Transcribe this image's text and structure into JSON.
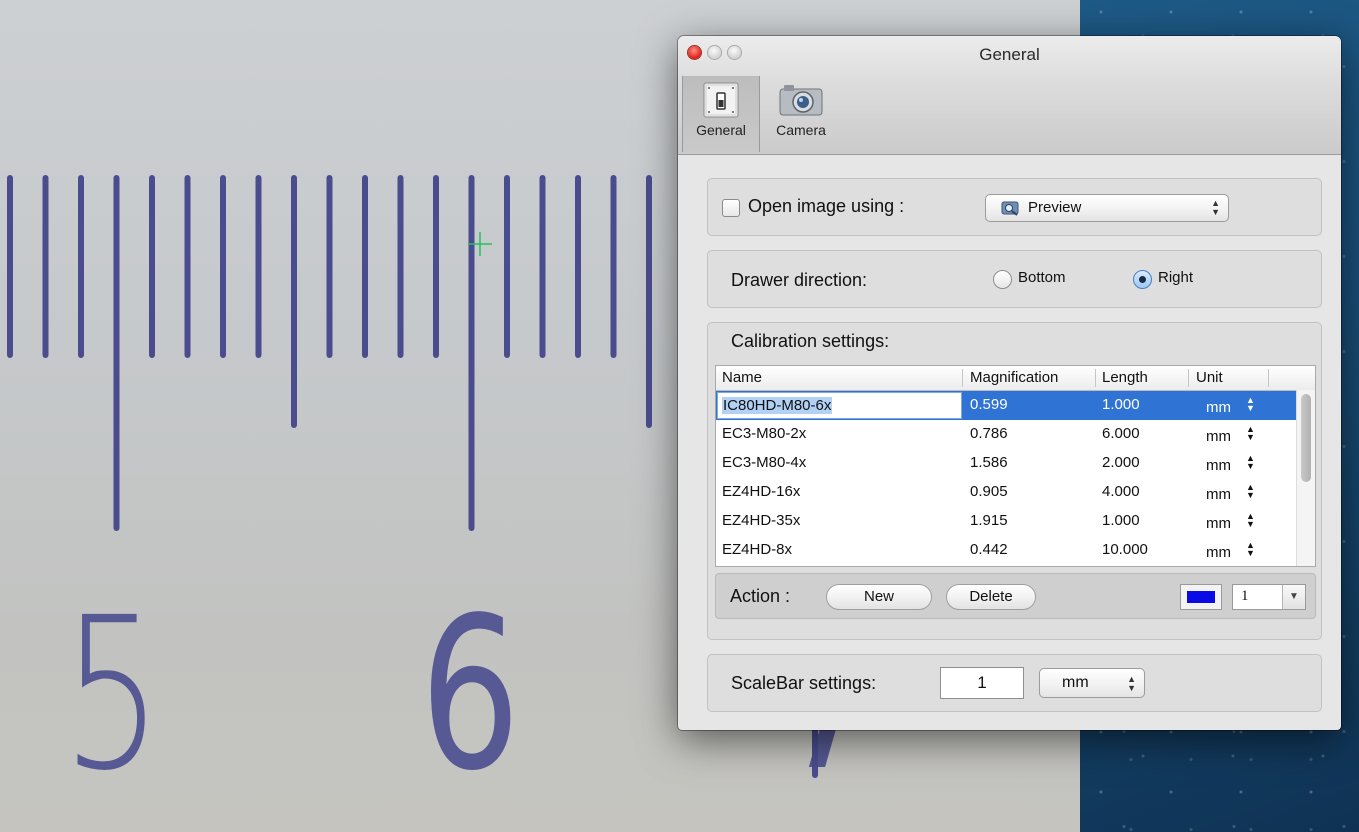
{
  "window": {
    "title": "General"
  },
  "toolbar": {
    "general_label": "General",
    "camera_label": "Camera"
  },
  "open_image": {
    "checkbox_checked": false,
    "label": "Open image using :",
    "app_value": "Preview"
  },
  "drawer": {
    "label": "Drawer direction:",
    "option_bottom": "Bottom",
    "option_right": "Right",
    "selected": "Right"
  },
  "calibration": {
    "title": "Calibration settings:",
    "columns": [
      "Name",
      "Magnification",
      "Length",
      "Unit"
    ],
    "rows": [
      {
        "name": "IC80HD-M80-6x",
        "magnification": "0.599",
        "length": "1.000",
        "unit": "mm"
      },
      {
        "name": "EC3-M80-2x",
        "magnification": "0.786",
        "length": "6.000",
        "unit": "mm"
      },
      {
        "name": "EC3-M80-4x",
        "magnification": "1.586",
        "length": "2.000",
        "unit": "mm"
      },
      {
        "name": "EZ4HD-16x",
        "magnification": "0.905",
        "length": "4.000",
        "unit": "mm"
      },
      {
        "name": "EZ4HD-35x",
        "magnification": "1.915",
        "length": "1.000",
        "unit": "mm"
      },
      {
        "name": "EZ4HD-8x",
        "magnification": "0.442",
        "length": "10.000",
        "unit": "mm"
      }
    ],
    "action_label": "Action :",
    "new_label": "New",
    "delete_label": "Delete",
    "line_color": "#0a0ae6",
    "line_width": "1"
  },
  "scalebar": {
    "label": "ScaleBar settings:",
    "value": "1",
    "unit": "mm"
  },
  "background": {
    "ruler_numbers": [
      "5",
      "6",
      "7"
    ]
  }
}
